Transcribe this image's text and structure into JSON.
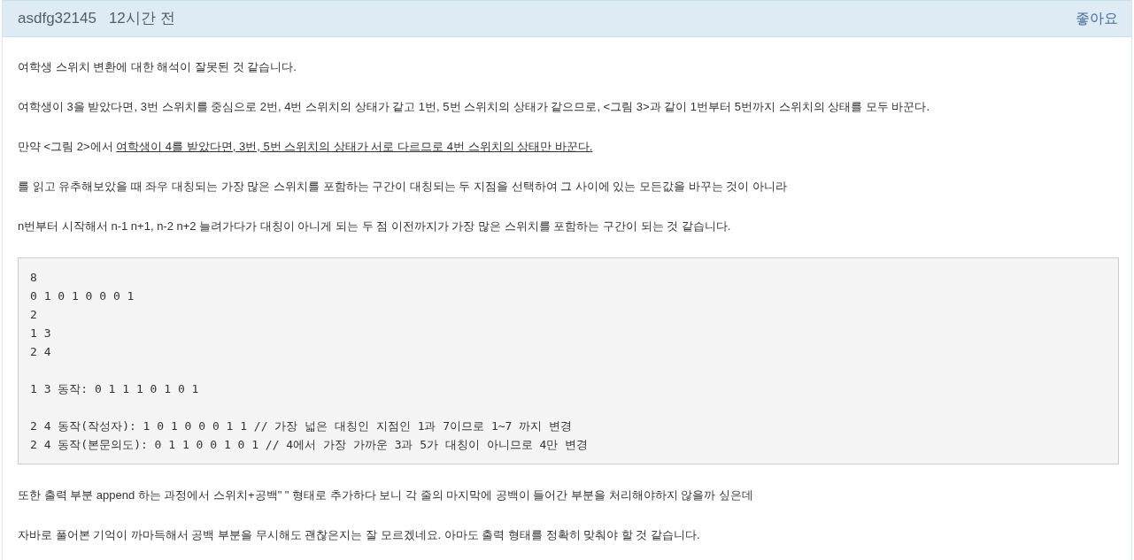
{
  "comment": {
    "author": "asdfg32145",
    "time": "12시간 전",
    "like_label": "좋아요"
  },
  "paragraphs_before": [
    {
      "text": "여학생 스위치 변환에 대한 해석이 잘못된 것 같습니다."
    },
    {
      "text": "여학생이 3을 받았다면, 3번 스위치를 중심으로 2번, 4번 스위치의 상태가 같고 1번, 5번 스위치의 상태가 같으므로, <그림 3>과 같이 1번부터 5번까지 스위치의 상태를 모두 바꾼다."
    },
    {
      "text": "만약 <그림 2>에서 ",
      "underlined": "여학생이 4를 받았다면, 3번, 5번 스위치의 상태가 서로 다르므로 4번 스위치의 상태만 바꾼다."
    },
    {
      "text": "를 읽고 유추해보았을 때 좌우 대칭되는 가장 많은 스위치를 포함하는 구간이 대칭되는 두 지점을 선택하여 그 사이에 있는 모든값을 바꾸는 것이 아니라"
    },
    {
      "text": "n번부터 시작해서 n-1 n+1, n-2 n+2 늘려가다가 대칭이 아니게 되는 두 점 이전까지가 가장 많은 스위치를 포함하는 구간이 되는 것 같습니다."
    }
  ],
  "code_groups": [
    [
      "8",
      "0 1 0 1 0 0 0 1",
      "2",
      "1 3",
      "2 4"
    ],
    [
      "1 3 동작: 0 1 1 1 0 1 0 1"
    ],
    [
      "2 4 동작(작성자): 1 0 1 0 0 0 1 1 // 가장 넓은 대칭인 지점인 1과 7이므로 1~7 까지 변경",
      "2 4 동작(본문의도): 0 1 1 0 0 1 0 1 // 4에서 가장 가까운 3과 5가 대칭이 아니므로 4만 변경"
    ]
  ],
  "paragraphs_after": [
    {
      "text": "또한 출력 부분 append 하는 과정에서 스위치+공백\" \" 형태로 추가하다 보니 각 줄의 마지막에 공백이 들어간 부분을 처리해야하지 않을까 싶은데"
    },
    {
      "text": "자바로 풀어본 기억이 까마득해서 공백 부분을 무시해도 괜찮은지는 잘 모르겠네요. 아마도 출력 형태를 정확히 맞춰야 할 것 같습니다."
    }
  ]
}
